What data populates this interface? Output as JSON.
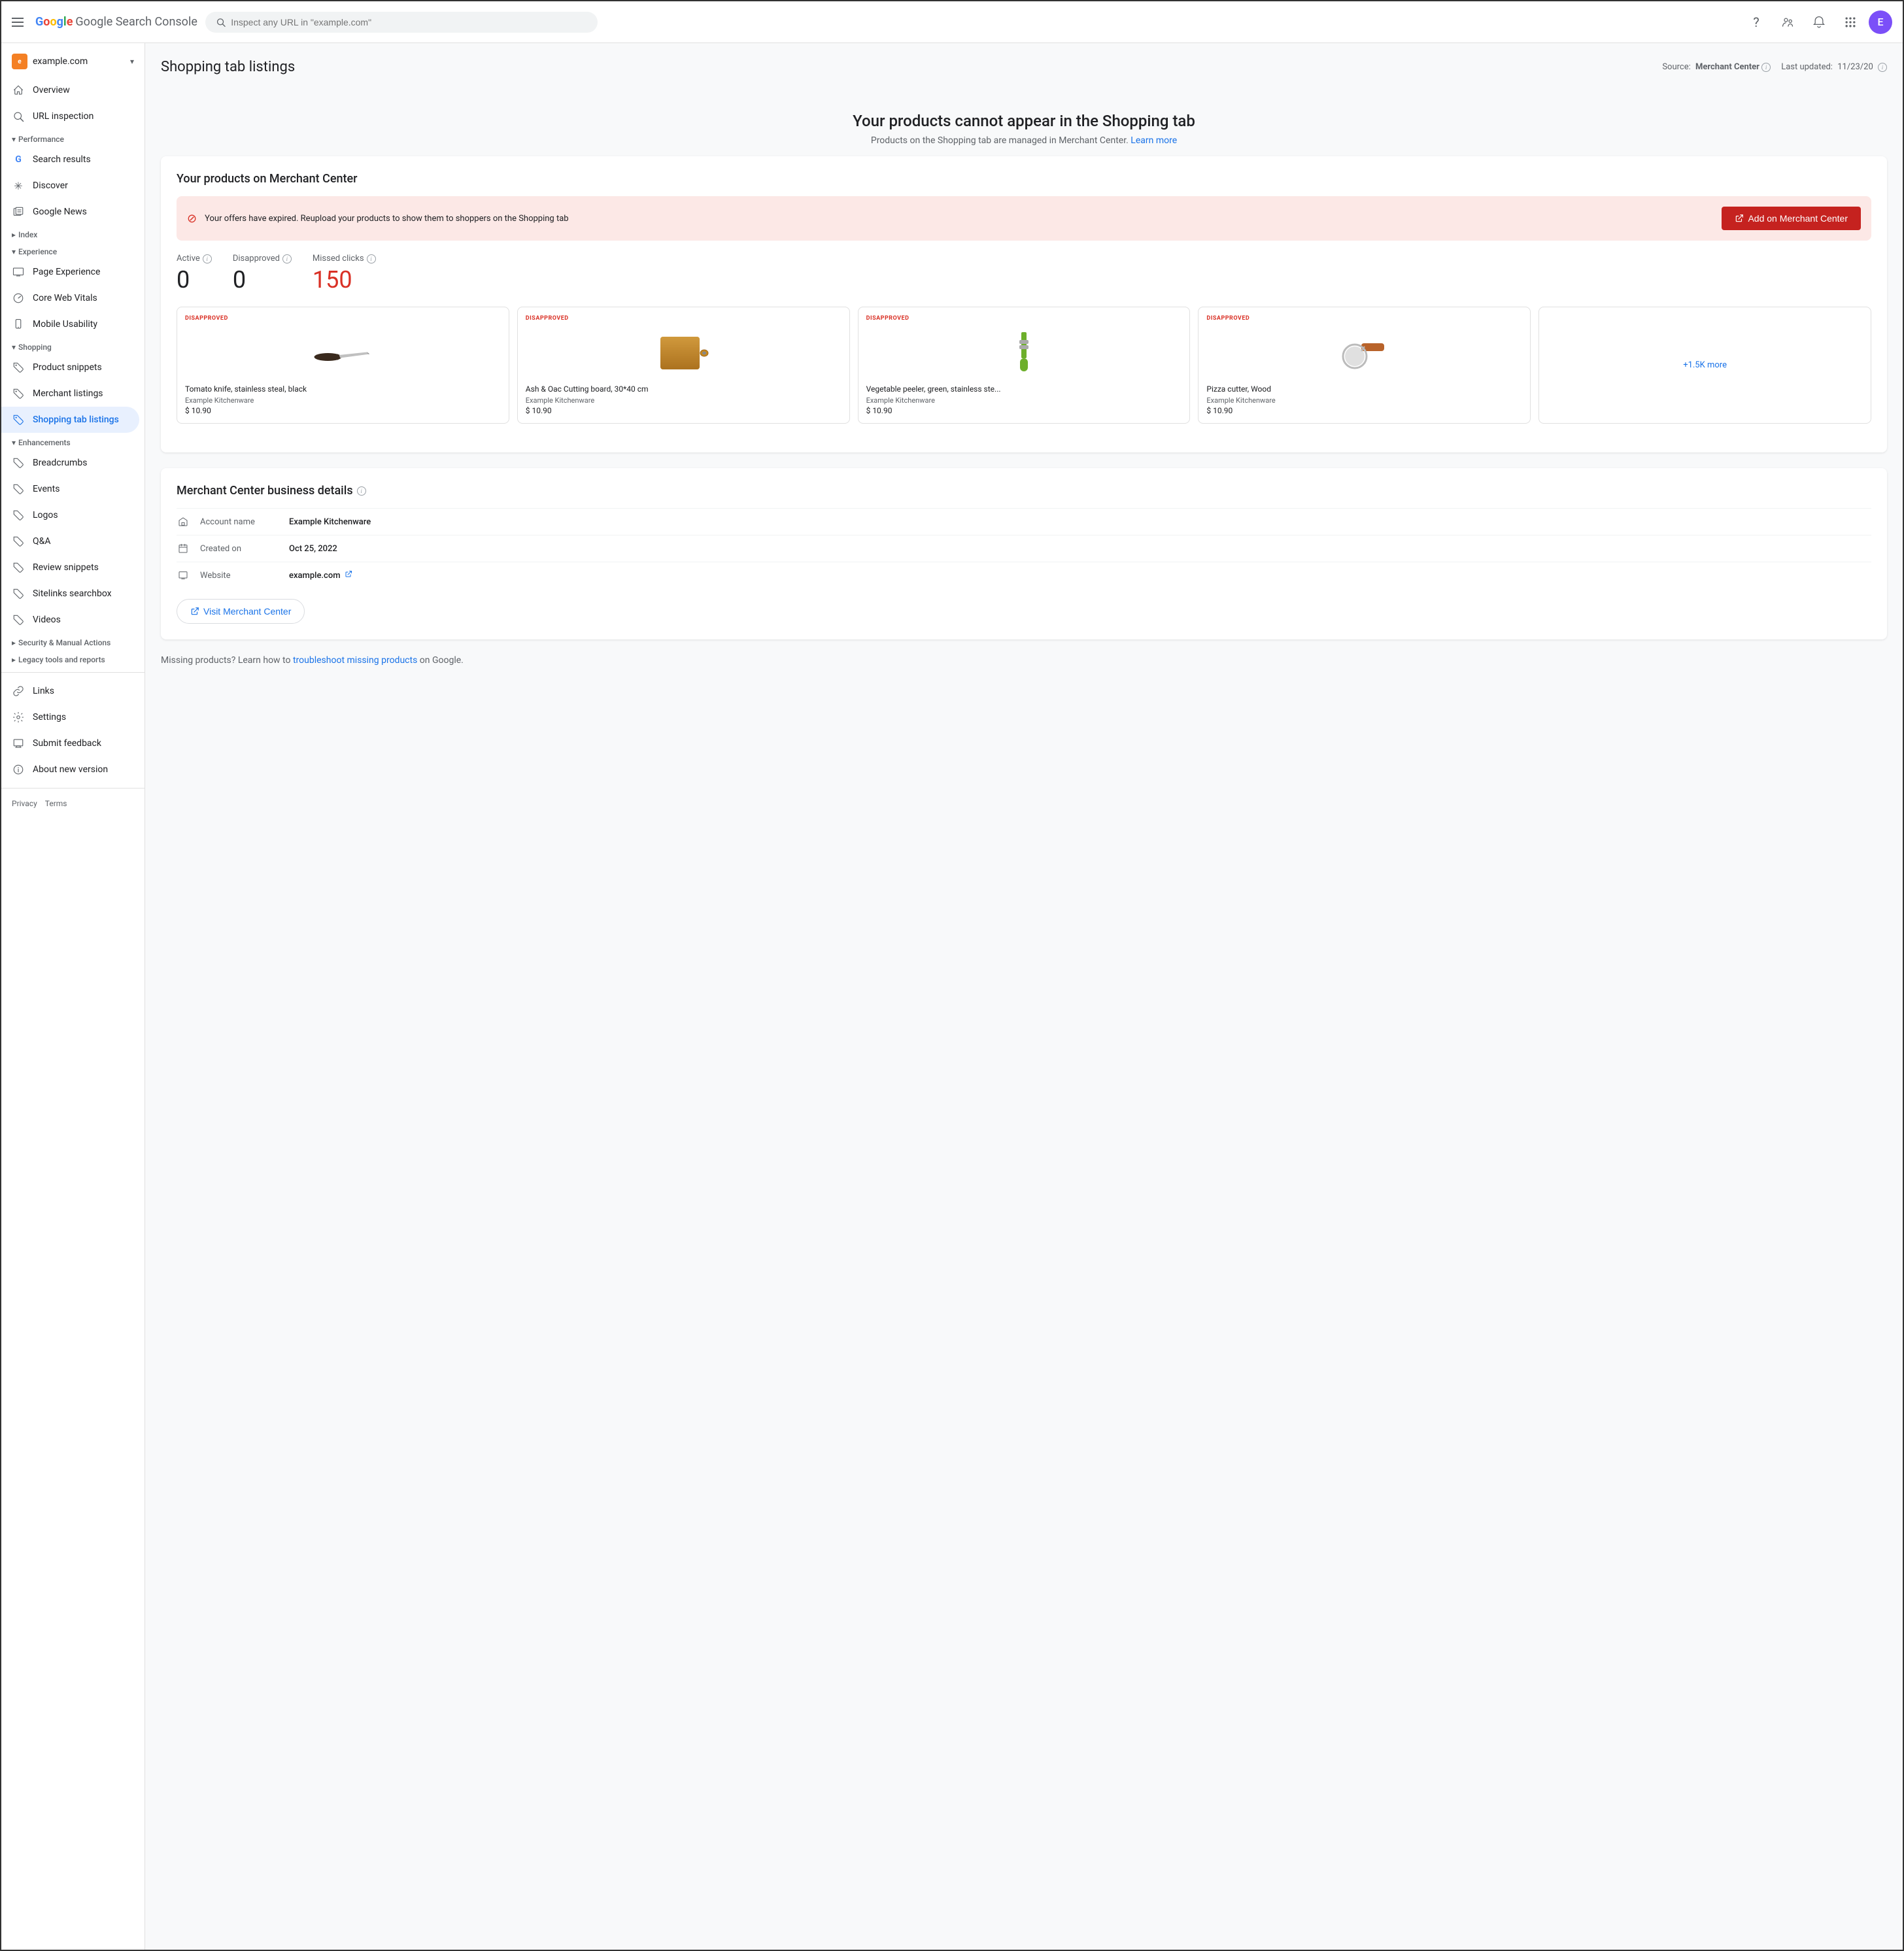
{
  "topbar": {
    "menu_icon_label": "Menu",
    "logo_text": "Google Search Console",
    "search_placeholder": "Inspect any URL in \"example.com\"",
    "avatar_letter": "E"
  },
  "sidebar": {
    "domain": "example.com",
    "items": [
      {
        "id": "overview",
        "label": "Overview",
        "icon": "home"
      },
      {
        "id": "url-inspection",
        "label": "URL inspection",
        "icon": "search"
      }
    ],
    "sections": [
      {
        "id": "performance",
        "label": "Performance",
        "expanded": true,
        "items": [
          {
            "id": "search-results",
            "label": "Search results",
            "icon": "google"
          },
          {
            "id": "discover",
            "label": "Discover",
            "icon": "asterisk"
          },
          {
            "id": "google-news",
            "label": "Google News",
            "icon": "news"
          }
        ]
      },
      {
        "id": "index",
        "label": "Index",
        "expanded": false,
        "items": []
      },
      {
        "id": "experience",
        "label": "Experience",
        "expanded": true,
        "items": [
          {
            "id": "page-experience",
            "label": "Page Experience",
            "icon": "monitor"
          },
          {
            "id": "core-web-vitals",
            "label": "Core Web Vitals",
            "icon": "gauge"
          },
          {
            "id": "mobile-usability",
            "label": "Mobile Usability",
            "icon": "mobile"
          }
        ]
      },
      {
        "id": "shopping",
        "label": "Shopping",
        "expanded": true,
        "items": [
          {
            "id": "product-snippets",
            "label": "Product snippets",
            "icon": "tag"
          },
          {
            "id": "merchant-listings",
            "label": "Merchant listings",
            "icon": "tag"
          },
          {
            "id": "shopping-tab-listings",
            "label": "Shopping tab listings",
            "icon": "tag",
            "active": true
          }
        ]
      },
      {
        "id": "enhancements",
        "label": "Enhancements",
        "expanded": true,
        "items": [
          {
            "id": "breadcrumbs",
            "label": "Breadcrumbs",
            "icon": "tag"
          },
          {
            "id": "events",
            "label": "Events",
            "icon": "tag"
          },
          {
            "id": "logos",
            "label": "Logos",
            "icon": "tag"
          },
          {
            "id": "qa",
            "label": "Q&A",
            "icon": "tag"
          },
          {
            "id": "review-snippets",
            "label": "Review snippets",
            "icon": "tag"
          },
          {
            "id": "sitelinks-searchbox",
            "label": "Sitelinks searchbox",
            "icon": "tag"
          },
          {
            "id": "videos",
            "label": "Videos",
            "icon": "tag"
          }
        ]
      },
      {
        "id": "security",
        "label": "Security & Manual Actions",
        "expanded": false,
        "items": []
      },
      {
        "id": "legacy",
        "label": "Legacy tools and reports",
        "expanded": false,
        "items": []
      }
    ],
    "bottom_items": [
      {
        "id": "links",
        "label": "Links",
        "icon": "link"
      },
      {
        "id": "settings",
        "label": "Settings",
        "icon": "gear"
      },
      {
        "id": "submit-feedback",
        "label": "Submit feedback",
        "icon": "feedback"
      },
      {
        "id": "about-new-version",
        "label": "About new version",
        "icon": "info"
      }
    ],
    "footer": [
      "Privacy",
      "Terms"
    ]
  },
  "page": {
    "title": "Shopping tab listings",
    "source_label": "Source:",
    "source_value": "Merchant Center",
    "last_updated_label": "Last updated:",
    "last_updated_value": "11/23/20"
  },
  "alert": {
    "title": "Your products cannot appear in the Shopping tab",
    "desc": "Products on the Shopping tab are managed in Merchant Center.",
    "link_text": "Learn more"
  },
  "merchant_card": {
    "title": "Your products on Merchant Center",
    "error_text": "Your offers have expired. Reupload your products to show them to shoppers on the Shopping tab",
    "add_button": "Add on Merchant Center",
    "stats": [
      {
        "id": "active",
        "label": "Active",
        "value": "0",
        "red": false
      },
      {
        "id": "disapproved",
        "label": "Disapproved",
        "value": "0",
        "red": false
      },
      {
        "id": "missed-clicks",
        "label": "Missed clicks",
        "value": "150",
        "red": true
      }
    ],
    "products": [
      {
        "id": "p1",
        "badge": "DISAPPROVED",
        "name": "Tomato knife, stainless steal, black",
        "brand": "Example Kitchenware",
        "price": "$ 10.90",
        "type": "knife"
      },
      {
        "id": "p2",
        "badge": "DISAPPROVED",
        "name": "Ash & Oac Cutting board, 30*40 cm",
        "brand": "Example Kitchenware",
        "price": "$ 10.90",
        "type": "board"
      },
      {
        "id": "p3",
        "badge": "DISAPPROVED",
        "name": "Vegetable peeler, green, stainless ste...",
        "brand": "Example Kitchenware",
        "price": "$ 10.90",
        "type": "peeler"
      },
      {
        "id": "p4",
        "badge": "DISAPPROVED",
        "name": "Pizza cutter, Wood",
        "brand": "Example Kitchenware",
        "price": "$ 10.90",
        "type": "cutter"
      }
    ],
    "more_label": "+1.5K more"
  },
  "business_details": {
    "title": "Merchant Center business details",
    "rows": [
      {
        "id": "account-name",
        "icon": "store",
        "label": "Account name",
        "value": "Example Kitchenware"
      },
      {
        "id": "created-on",
        "icon": "calendar",
        "label": "Created on",
        "value": "Oct 25, 2022"
      },
      {
        "id": "website",
        "icon": "web",
        "label": "Website",
        "value": "example.com",
        "has_link": true
      }
    ],
    "visit_button": "Visit Merchant Center"
  },
  "footer": {
    "missing_text": "Missing products? Learn how to",
    "link_text": "troubleshoot missing products",
    "suffix": "on Google."
  }
}
